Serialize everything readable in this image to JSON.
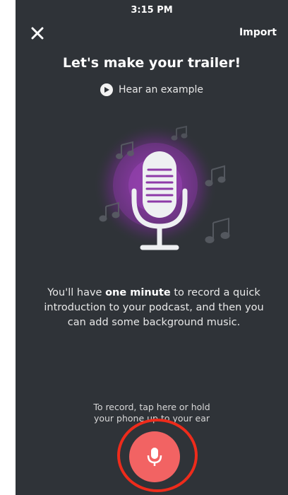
{
  "status_bar": {
    "time": "3:15 PM"
  },
  "header": {
    "import_label": "Import"
  },
  "main": {
    "title": "Let's make your trailer!",
    "example_label": "Hear an example",
    "description": {
      "part1": "You'll have ",
      "bold": "one minute",
      "part2": " to record a quick introduction to your podcast, and then you can add some background music."
    },
    "hint": {
      "line1": "To record, tap here or hold",
      "line2": "your phone up to your ear"
    }
  },
  "colors": {
    "background": "#2f3338",
    "record_button": "#f26363",
    "highlight_ring": "#ee2b1b",
    "glow": "#8e3aa8"
  },
  "icons": [
    "close-icon",
    "play-icon",
    "microphone-illustration",
    "music-note-icon",
    "microphone-icon"
  ]
}
